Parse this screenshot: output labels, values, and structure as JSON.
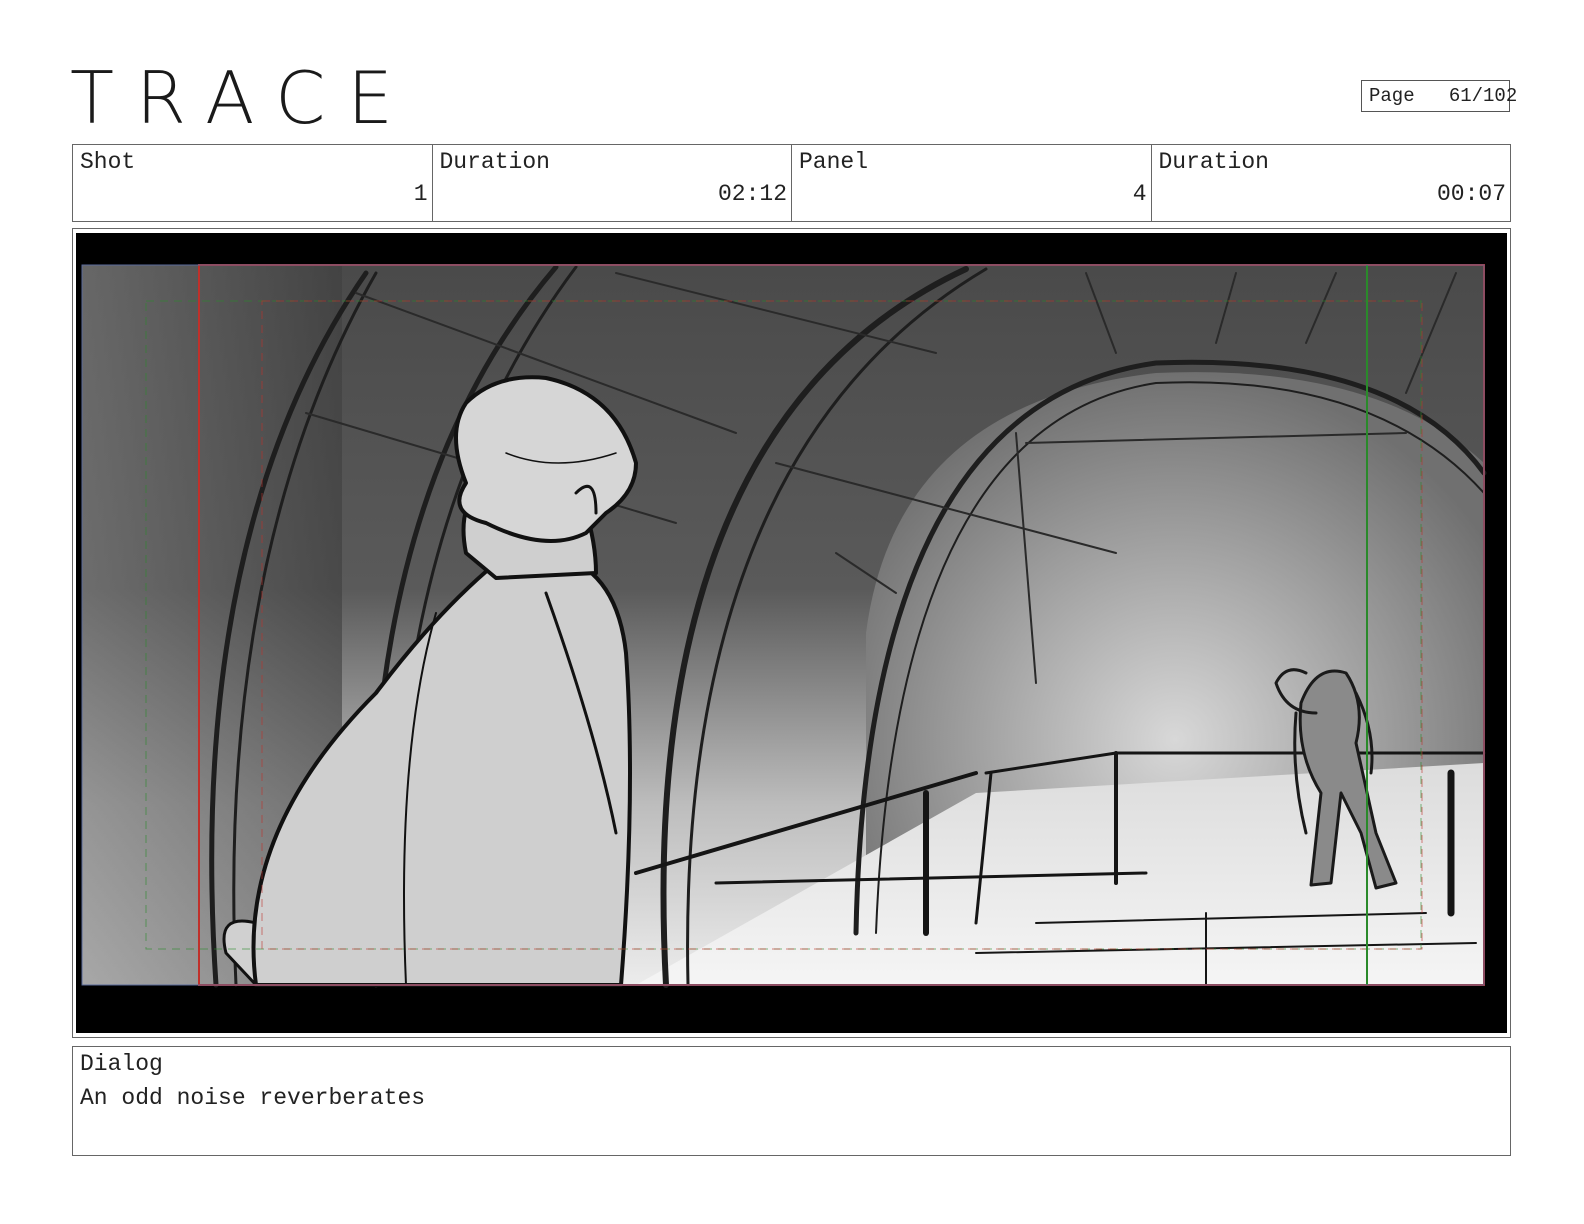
{
  "header": {
    "logo_text": "TRACE",
    "page_label": "Page",
    "page_number": "61/102"
  },
  "info": {
    "shot_label": "Shot",
    "shot_value": "1",
    "shot_duration_label": "Duration",
    "shot_duration_value": "02:12",
    "panel_label": "Panel",
    "panel_value": "4",
    "panel_duration_label": "Duration",
    "panel_duration_value": "00:07"
  },
  "dialog": {
    "label": "Dialog",
    "text": "An odd noise reverberates"
  },
  "colors": {
    "guide_red": "#c0302a",
    "guide_green": "#2a8a2a",
    "letterbox": "#000000"
  }
}
